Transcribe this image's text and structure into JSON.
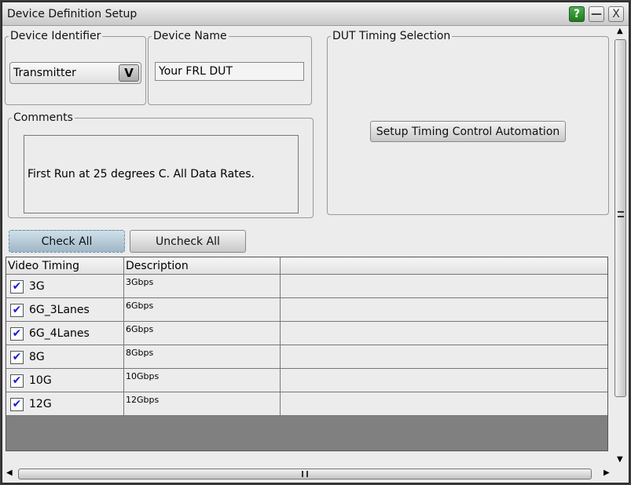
{
  "window": {
    "title": "Device Definition Setup",
    "help_label": "?",
    "minimize_label": "—",
    "close_label": "X"
  },
  "device_identifier": {
    "label": "Device Identifier",
    "value": "Transmitter",
    "dropdown_glyph": "V"
  },
  "device_name": {
    "label": "Device Name",
    "value": "Your FRL DUT"
  },
  "comments": {
    "label": "Comments",
    "value": "First Run at 25 degrees C.  All Data Rates."
  },
  "dut_timing": {
    "label": "DUT Timing Selection",
    "button_label": "Setup Timing Control Automation"
  },
  "buttons": {
    "check_all": "Check All",
    "uncheck_all": "Uncheck All"
  },
  "table": {
    "headers": [
      "Video Timing",
      "Description",
      ""
    ],
    "rows": [
      {
        "name": "3G",
        "description": "3Gbps",
        "checked": true
      },
      {
        "name": "6G_3Lanes",
        "description": "6Gbps",
        "checked": true
      },
      {
        "name": "6G_4Lanes",
        "description": "6Gbps",
        "checked": true
      },
      {
        "name": "8G",
        "description": "8Gbps",
        "checked": true
      },
      {
        "name": "10G",
        "description": "10Gbps",
        "checked": true
      },
      {
        "name": "12G",
        "description": "12Gbps",
        "checked": true
      }
    ],
    "check_glyph": "✔"
  },
  "colors": {
    "help_green": "#2e8b2e",
    "check_blue": "#1a1adc",
    "table_empty": "#808080"
  }
}
